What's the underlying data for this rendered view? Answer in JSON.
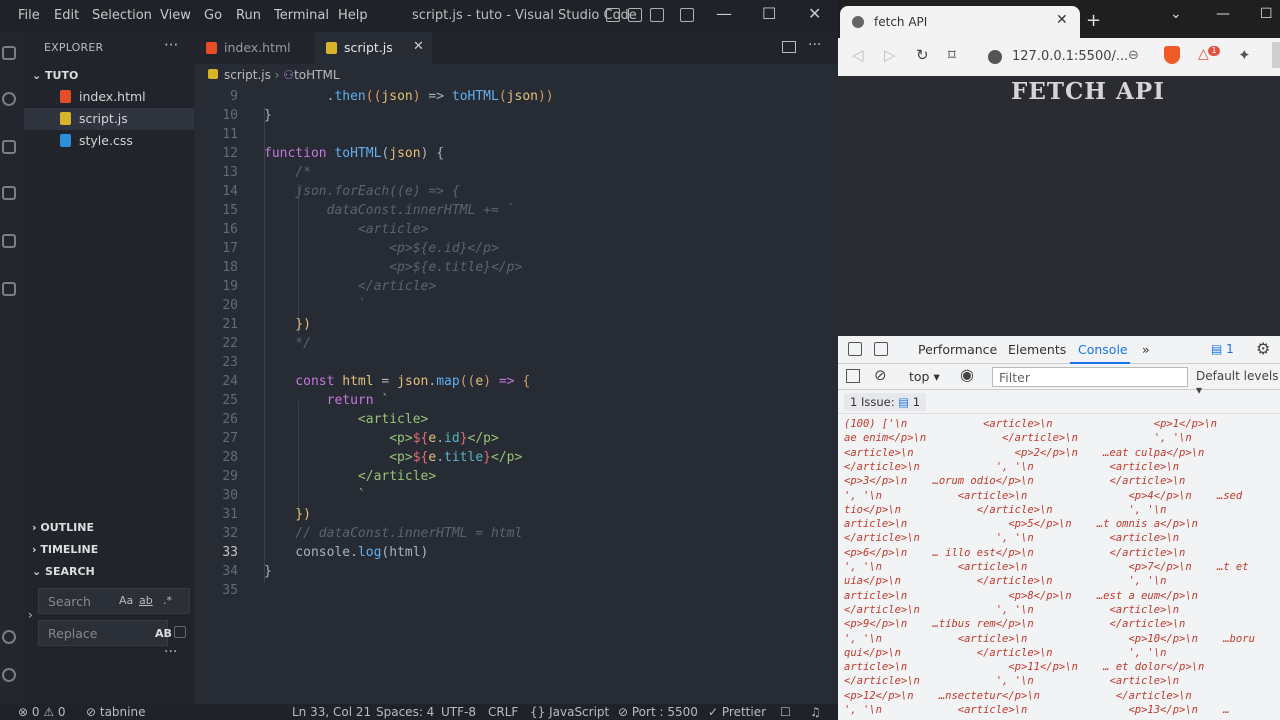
{
  "vscode": {
    "menu": [
      "File",
      "Edit",
      "Selection",
      "View",
      "Go",
      "Run",
      "Terminal",
      "Help"
    ],
    "window_title": "script.js - tuto - Visual Studio Code",
    "explorer": {
      "title": "EXPLORER",
      "folder": "TUTO",
      "files": [
        "index.html",
        "script.js",
        "style.css"
      ]
    },
    "panels": {
      "outline": "OUTLINE",
      "timeline": "TIMELINE",
      "search": "SEARCH"
    },
    "search": {
      "placeholder": "Search",
      "replace_placeholder": "Replace",
      "opt_case": "Aa",
      "opt_word": "ab",
      "opt_regex": ".*",
      "opt_preserve": "AB"
    },
    "tabs": [
      {
        "label": "index.html"
      },
      {
        "label": "script.js"
      }
    ],
    "breadcrumb": {
      "file": "script.js",
      "symbol": "toHTML"
    },
    "code_lines": [
      {
        "n": "9",
        "segs": [
          [
            "pl",
            "        "
          ],
          [
            "pl",
            "."
          ],
          [
            "fn",
            "then"
          ],
          [
            "br",
            "(("
          ],
          [
            "var",
            "json"
          ],
          [
            "br",
            ")"
          ],
          [
            "pl",
            " => "
          ],
          [
            "fn",
            "toHTML"
          ],
          [
            "br",
            "("
          ],
          [
            "var",
            "json"
          ],
          [
            "br",
            "))"
          ]
        ]
      },
      {
        "n": "10",
        "segs": [
          [
            "pl",
            "}"
          ]
        ]
      },
      {
        "n": "11",
        "segs": []
      },
      {
        "n": "12",
        "segs": [
          [
            "kw",
            "function "
          ],
          [
            "fn",
            "toHTML"
          ],
          [
            "pl",
            "("
          ],
          [
            "var",
            "json"
          ],
          [
            "pl",
            ") {"
          ]
        ]
      },
      {
        "n": "13",
        "segs": [
          [
            "cm",
            "    /*"
          ]
        ]
      },
      {
        "n": "14",
        "segs": [
          [
            "cm",
            "    json.forEach((e) => {"
          ]
        ]
      },
      {
        "n": "15",
        "segs": [
          [
            "cm",
            "        dataConst.innerHTML += `"
          ]
        ]
      },
      {
        "n": "16",
        "segs": [
          [
            "cm",
            "            <article>"
          ]
        ]
      },
      {
        "n": "17",
        "segs": [
          [
            "cm",
            "                <p>${e.id}</p>"
          ]
        ]
      },
      {
        "n": "18",
        "segs": [
          [
            "cm",
            "                <p>${e.title}</p>"
          ]
        ]
      },
      {
        "n": "19",
        "segs": [
          [
            "cm",
            "            </article>"
          ]
        ]
      },
      {
        "n": "20",
        "segs": [
          [
            "cm",
            "            `"
          ]
        ]
      },
      {
        "n": "21",
        "segs": [
          [
            "var",
            "    })"
          ]
        ]
      },
      {
        "n": "22",
        "segs": [
          [
            "cm",
            "    */"
          ]
        ]
      },
      {
        "n": "23",
        "segs": []
      },
      {
        "n": "24",
        "segs": [
          [
            "kw",
            "    const "
          ],
          [
            "var",
            "html"
          ],
          [
            "pl",
            " = "
          ],
          [
            "var",
            "json"
          ],
          [
            "pl",
            "."
          ],
          [
            "fn",
            "map"
          ],
          [
            "br",
            "(("
          ],
          [
            "var",
            "e"
          ],
          [
            "br",
            ")"
          ],
          [
            "kw",
            " => "
          ],
          [
            "br",
            "{"
          ]
        ]
      },
      {
        "n": "25",
        "segs": [
          [
            "kw",
            "        return "
          ],
          [
            "str",
            "`"
          ]
        ]
      },
      {
        "n": "26",
        "segs": [
          [
            "str",
            "            <article>"
          ]
        ]
      },
      {
        "n": "27",
        "segs": [
          [
            "str",
            "                <p>"
          ],
          [
            "tag",
            "${"
          ],
          [
            "var",
            "e"
          ],
          [
            "pl",
            "."
          ],
          [
            "id",
            "id"
          ],
          [
            "tag",
            "}"
          ],
          [
            "str",
            "</p>"
          ]
        ]
      },
      {
        "n": "28",
        "segs": [
          [
            "str",
            "                <p>"
          ],
          [
            "tag",
            "${"
          ],
          [
            "var",
            "e"
          ],
          [
            "pl",
            "."
          ],
          [
            "id",
            "title"
          ],
          [
            "tag",
            "}"
          ],
          [
            "str",
            "</p>"
          ]
        ]
      },
      {
        "n": "29",
        "segs": [
          [
            "str",
            "            </article>"
          ]
        ]
      },
      {
        "n": "30",
        "segs": [
          [
            "str",
            "            `"
          ]
        ]
      },
      {
        "n": "31",
        "segs": [
          [
            "var",
            "    })"
          ]
        ]
      },
      {
        "n": "32",
        "segs": [
          [
            "cm",
            "    // dataConst.innerHTML = html"
          ]
        ]
      },
      {
        "n": "33",
        "segs": [
          [
            "pl",
            "    console."
          ],
          [
            "fn",
            "log"
          ],
          [
            "pl",
            "(html)"
          ]
        ]
      },
      {
        "n": "34",
        "segs": [
          [
            "pl",
            "}"
          ]
        ]
      },
      {
        "n": "35",
        "segs": []
      }
    ],
    "current_line": "33",
    "status": {
      "errors": "0",
      "warnings": "0",
      "tabnine": "tabnine",
      "position": "Ln 33, Col 21",
      "spaces": "Spaces: 4",
      "encoding": "UTF-8",
      "eol": "CRLF",
      "language": "JavaScript",
      "port": "Port : 5500",
      "prettier": "Prettier"
    }
  },
  "browser": {
    "tab_title": "fetch API",
    "url": "127.0.0.1:5500/...",
    "rewards_count": "1",
    "page_heading": "FETCH API",
    "devtools": {
      "tabs": [
        "Performance",
        "Elements",
        "Console"
      ],
      "active_tab": "Console",
      "messages_badge": "1",
      "context": "top",
      "filter_placeholder": "Filter",
      "levels": "Default levels",
      "issues": "1 Issue:",
      "issues_count": "1",
      "log_lines": [
        "(100) ['\\n            <article>\\n                <p>1</p>\\n",
        "ae enim</p>\\n            </article>\\n            ', '\\n",
        "<article>\\n                <p>2</p>\\n    …eat culpa</p>\\n",
        "</article>\\n            ', '\\n            <article>\\n",
        "<p>3</p>\\n    …orum odio</p>\\n            </article>\\n",
        "', '\\n            <article>\\n                <p>4</p>\\n    …sed",
        "tio</p>\\n            </article>\\n            ', '\\n",
        "article>\\n                <p>5</p>\\n    …t omnis a</p>\\n",
        "</article>\\n            ', '\\n            <article>\\n",
        "<p>6</p>\\n    … illo est</p>\\n            </article>\\n",
        "', '\\n            <article>\\n                <p>7</p>\\n    …t et",
        "uia</p>\\n            </article>\\n            ', '\\n",
        "article>\\n                <p>8</p>\\n    …est a eum</p>\\n",
        "</article>\\n            ', '\\n            <article>\\n",
        "<p>9</p>\\n    …tibus rem</p>\\n            </article>\\n",
        "', '\\n            <article>\\n                <p>10</p>\\n    …boru",
        "qui</p>\\n            </article>\\n            ', '\\n",
        "article>\\n                <p>11</p>\\n    … et dolor</p>\\n",
        "</article>\\n            ', '\\n            <article>\\n",
        "<p>12</p>\\n    …nsectetur</p>\\n            </article>\\n",
        "', '\\n            <article>\\n                <p>13</p>\\n    …"
      ]
    }
  }
}
